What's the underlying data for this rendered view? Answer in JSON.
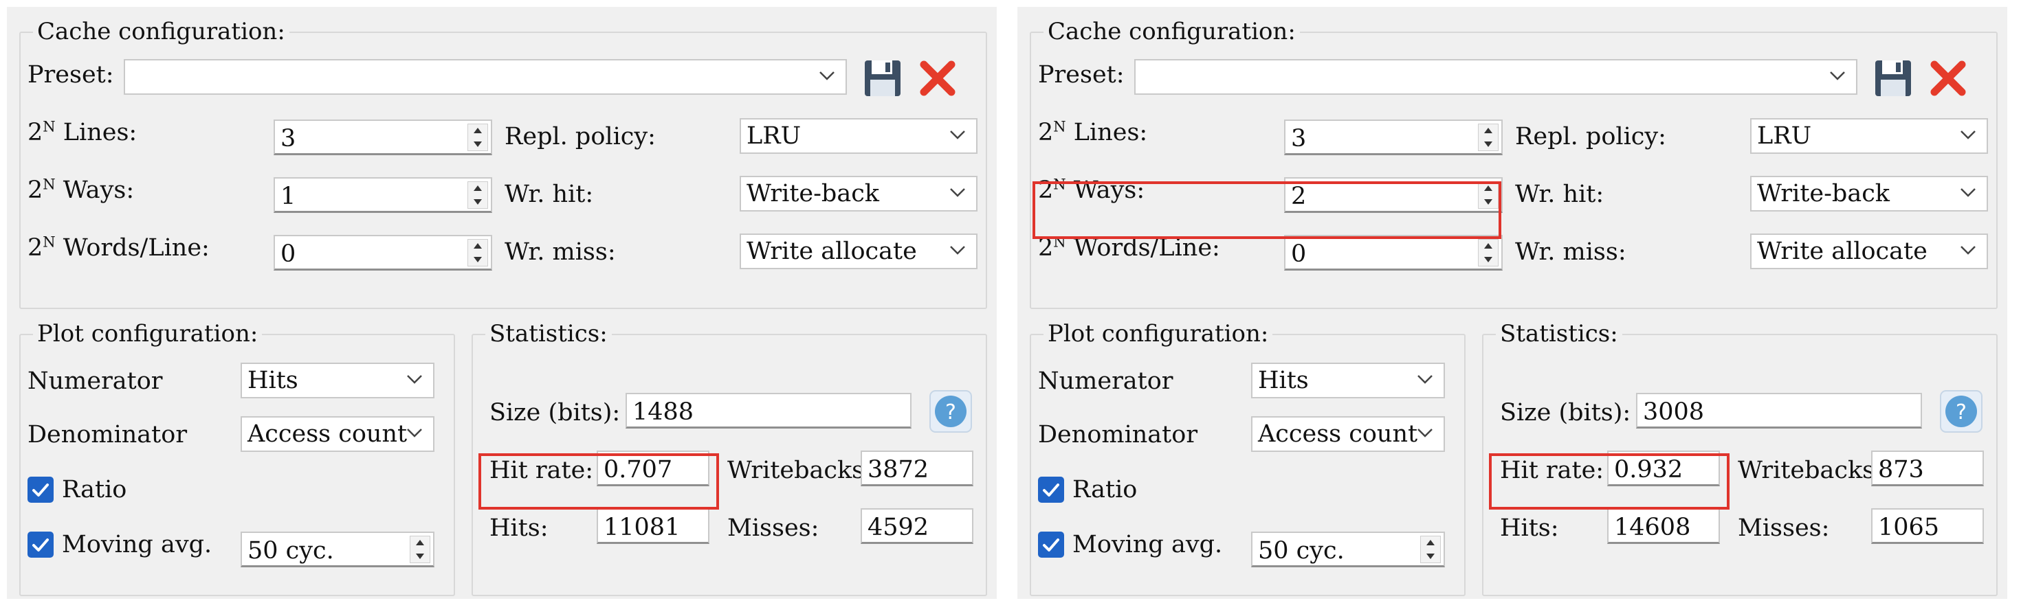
{
  "left": {
    "cache": {
      "title": "Cache configuration:",
      "preset_label": "Preset:",
      "preset_value": "",
      "lines_label_base": "2",
      "lines_label_sup": "N",
      "lines_label_rest": " Lines:",
      "lines_value": "3",
      "ways_label_base": "2",
      "ways_label_sup": "N",
      "ways_label_rest": " Ways:",
      "ways_value": "1",
      "words_label_base": "2",
      "words_label_sup": "N",
      "words_label_rest": " Words/Line:",
      "words_value": "0",
      "repl_label": "Repl. policy:",
      "repl_value": "LRU",
      "wrhit_label": "Wr. hit:",
      "wrhit_value": "Write-back",
      "wrmiss_label": "Wr. miss:",
      "wrmiss_value": "Write allocate"
    },
    "plot": {
      "title": "Plot configuration:",
      "numerator_label": "Numerator",
      "numerator_value": "Hits",
      "denominator_label": "Denominator",
      "denominator_value": "Access count",
      "ratio_label": "Ratio",
      "ratio_checked": true,
      "moving_label": "Moving avg.",
      "moving_checked": true,
      "moving_value": "50 cyc."
    },
    "stats": {
      "title": "Statistics:",
      "size_label": "Size (bits):",
      "size_value": "1488",
      "hitrate_label": "Hit rate:",
      "hitrate_value": "0.707",
      "writebacks_label": "Writebacks:",
      "writebacks_value": "3872",
      "hits_label": "Hits:",
      "hits_value": "11081",
      "misses_label": "Misses:",
      "misses_value": "4592"
    }
  },
  "right": {
    "cache": {
      "title": "Cache configuration:",
      "preset_label": "Preset:",
      "preset_value": "",
      "lines_label_base": "2",
      "lines_label_sup": "N",
      "lines_label_rest": " Lines:",
      "lines_value": "3",
      "ways_label_base": "2",
      "ways_label_sup": "N",
      "ways_label_rest": " Ways:",
      "ways_value": "2",
      "words_label_base": "2",
      "words_label_sup": "N",
      "words_label_rest": " Words/Line:",
      "words_value": "0",
      "repl_label": "Repl. policy:",
      "repl_value": "LRU",
      "wrhit_label": "Wr. hit:",
      "wrhit_value": "Write-back",
      "wrmiss_label": "Wr. miss:",
      "wrmiss_value": "Write allocate"
    },
    "plot": {
      "title": "Plot configuration:",
      "numerator_label": "Numerator",
      "numerator_value": "Hits",
      "denominator_label": "Denominator",
      "denominator_value": "Access count",
      "ratio_label": "Ratio",
      "ratio_checked": true,
      "moving_label": "Moving avg.",
      "moving_checked": true,
      "moving_value": "50 cyc."
    },
    "stats": {
      "title": "Statistics:",
      "size_label": "Size (bits):",
      "size_value": "3008",
      "hitrate_label": "Hit rate:",
      "hitrate_value": "0.932",
      "writebacks_label": "Writebacks:",
      "writebacks_value": "873",
      "hits_label": "Hits:",
      "hits_value": "14608",
      "misses_label": "Misses:",
      "misses_value": "1065"
    }
  },
  "icons": {
    "save": "floppy-disk-icon",
    "clear": "red-x-icon",
    "help": "question-mark-icon",
    "dropdown": "chevron-down-icon",
    "spinner": "up-down-arrows-icon",
    "checkbox": "checkmark-icon"
  },
  "colors": {
    "highlight": "#e0342c",
    "checkbox": "#1f63c6",
    "help": "#5a9fd6",
    "clear": "#e53b2a",
    "panel": "#f0f0f0"
  }
}
